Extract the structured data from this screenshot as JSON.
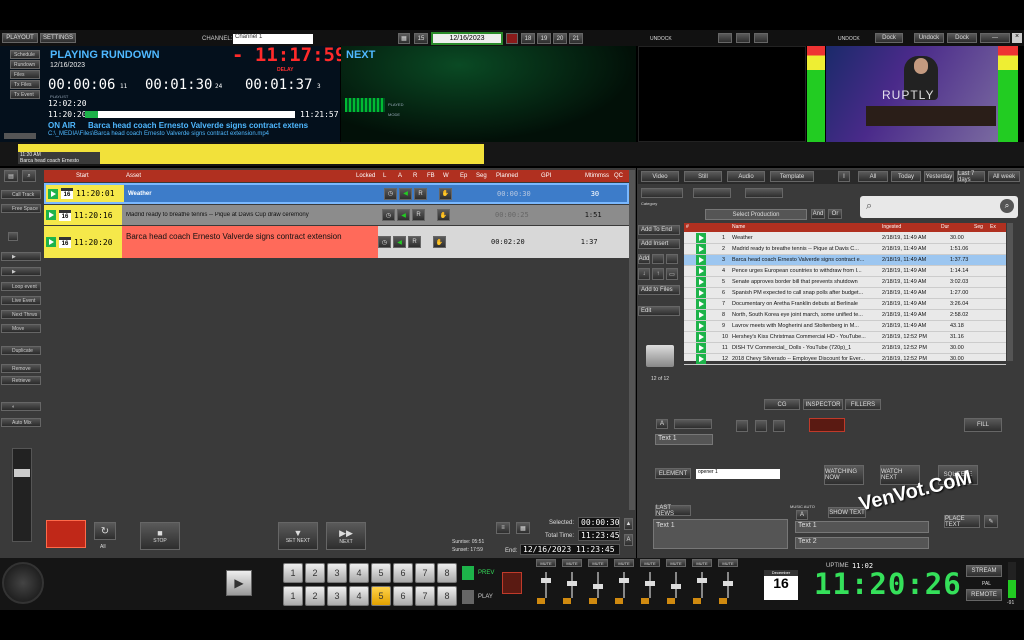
{
  "top_tabs": [
    "PLAYOUT",
    "SETTINGS"
  ],
  "channel": {
    "label": "CHANNEL:",
    "value": "Channel 1"
  },
  "date_nav": {
    "value": "12/16/2023",
    "days": [
      "15",
      "18",
      "19",
      "20",
      "21"
    ]
  },
  "playing": {
    "title": "PLAYING RUNDOWN",
    "date": "12/16/2023",
    "countdown": "- 11:17:59",
    "delay_label": "DELAY",
    "elapsed": "00:00:06",
    "elapsed_frames": "11",
    "remain": "00:01:30",
    "remain_frames": "24",
    "total": "00:01:37",
    "total_frames": "3",
    "playlist_label": "PLAYLIST",
    "on_air_label": "ON AIR",
    "start_time": "12:02:20",
    "time_a": "11:20:20",
    "time_b": "11:21:57",
    "onair_clip": "Barca head coach Ernesto Valverde signs contract extens",
    "onair_path": "C:\\_MEDIA\\Files\\Barca head coach Ernesto Valverde signs contract extension.mp4"
  },
  "next": {
    "title": "NEXT",
    "played_label": "PLAYED",
    "mode_label": "MODE"
  },
  "mini_side": [
    "Schedule",
    "Rundown",
    "Files",
    "Tx Files",
    "Tx Event"
  ],
  "timeline": {
    "time": "11:20 AM",
    "clip": "Barca head coach Ernesto"
  },
  "undock": [
    "UNDOCK",
    "UNDOCK"
  ],
  "top_right_buttons": [
    "Dock",
    "Undock",
    "Dock",
    "Undock"
  ],
  "preview": {
    "watermark": "RUPTLY"
  },
  "columns": [
    "Start",
    "Asset",
    "Locked",
    "L",
    "A",
    "R",
    "FB",
    "W",
    "Ep",
    "Seg",
    "Planned",
    "GPI",
    "Mtimmss",
    "QC"
  ],
  "rows": [
    {
      "start": "11:20:01",
      "date": "16",
      "asset": "Weather",
      "planned": "00:00:30",
      "dur": "30"
    },
    {
      "start": "11:20:16",
      "date": "16",
      "asset": "Madrid ready to breathe tennis -- Pique at Davis Cup draw ceremony",
      "planned": "00:00:25",
      "dur": "1:51"
    },
    {
      "start": "11:20:20",
      "date": "16",
      "asset": "Barca head coach Ernesto Valverde signs contract extension",
      "planned": "00:02:20",
      "dur": "1:37"
    }
  ],
  "left_side": [
    "Call Track",
    "Free Space",
    "",
    "",
    "",
    "Loop event",
    "Live Event",
    "Next Thrws",
    "Move",
    "Duplicate",
    "Remove",
    "Retrieve",
    "Auto Mix"
  ],
  "bottom_controls": {
    "stop": "STOP",
    "set_next": "SET NEXT",
    "next": "NEXT",
    "all": "All"
  },
  "sun": {
    "sunrise": "Sunrise: 05:51",
    "sunset": "Sunset: 17:59"
  },
  "totals": {
    "selected_label": "Selected:",
    "selected": "00:00:30",
    "total_label": "Total Time:",
    "total": "11:23:45",
    "end_label": "End:",
    "end": "12/16/2023 11:23:45"
  },
  "lib_tabs": [
    "Video",
    "Still",
    "Audio",
    "Template"
  ],
  "filter_tabs": [
    "All",
    "Today",
    "Yesterday",
    "Last 7 days",
    "All week"
  ],
  "production": {
    "category": "Category",
    "select": "Select Production",
    "and": "And",
    "or": "Or"
  },
  "lib_buttons": [
    "Add To End",
    "Add Insert",
    "Add",
    "Add to Files",
    "Edit"
  ],
  "lib_columns": [
    "#",
    "Name",
    "Ingested",
    "Dur",
    "Seg",
    "Ex"
  ],
  "lib_rows": [
    {
      "n": "1",
      "name": "Weather",
      "ing": "2/18/19, 11:49 AM",
      "dur": "30.00"
    },
    {
      "n": "2",
      "name": "Madrid ready to breathe tennis -- Pique at Davis C...",
      "ing": "2/18/19, 11:49 AM",
      "dur": "1:51.06"
    },
    {
      "n": "3",
      "name": "Barca head coach Ernesto Valverde signs contract e...",
      "ing": "2/18/19, 11:49 AM",
      "dur": "1:37.73"
    },
    {
      "n": "4",
      "name": "Pence urges European countries to withdraw from I...",
      "ing": "2/18/19, 11:49 AM",
      "dur": "1:14.14"
    },
    {
      "n": "5",
      "name": "Senate approves border bill that prevents shutdown",
      "ing": "2/18/19, 11:49 AM",
      "dur": "3:02.03"
    },
    {
      "n": "6",
      "name": "Spanish PM expected to call snap polls after budget...",
      "ing": "2/18/19, 11:49 AM",
      "dur": "1:27.00"
    },
    {
      "n": "7",
      "name": "Documentary on Aretha Franklin debuts at Berlinale",
      "ing": "2/18/19, 11:49 AM",
      "dur": "3:26.04"
    },
    {
      "n": "8",
      "name": "North, South Korea eye joint march, some unified te...",
      "ing": "2/18/19, 11:49 AM",
      "dur": "2:58.02"
    },
    {
      "n": "9",
      "name": "Lavrov meets with Mogherini and Stoltenberg in M...",
      "ing": "2/18/19, 11:49 AM",
      "dur": "43.18"
    },
    {
      "n": "10",
      "name": "Hershey's Kiss Christmas Commercial HD - YouTube...",
      "ing": "2/18/19, 12:52 PM",
      "dur": "31.16"
    },
    {
      "n": "11",
      "name": "DISH TV Commercial_ Dolls - YouTube (720p)_1",
      "ing": "2/18/19, 12:52 PM",
      "dur": "30.00"
    },
    {
      "n": "12",
      "name": "2018 Chevy Silverado -- Employee Discount for Ever...",
      "ing": "2/18/19, 12:52 PM",
      "dur": "30.00"
    }
  ],
  "lib_count": "12 of 12",
  "lower_tabs": [
    "CG",
    "INSPECTOR",
    "FILLERS"
  ],
  "cg": {
    "text1": "Text 1",
    "element_label": "ELEMENT",
    "element_value": "opener 1",
    "watching_now": "WATCHING NOW",
    "watch_next": "WATCH NEXT",
    "squeeze": "SQUEEZE",
    "last_news": "LAST NEWS",
    "music_auto": "MUSIC AUTO",
    "text_a": "Text 1",
    "text_b": "Text 1",
    "text_c": "Text 2",
    "show_text": "SHOW TEXT",
    "place": "PLACE TEXT",
    "fill": "FILL"
  },
  "numpad": [
    "1",
    "2",
    "3",
    "4",
    "5",
    "6",
    "7",
    "8"
  ],
  "numpad_active": 5,
  "prev_label": "PREV",
  "play_label": "PLAY",
  "mixer_labels": [
    "MUTE",
    "MUTE",
    "MUTE",
    "MUTE",
    "MUTE",
    "MUTE",
    "MUTE",
    "MUTE"
  ],
  "clock": {
    "uptime_label": "UPTIME",
    "uptime": "11:02",
    "time": "11:20:26",
    "day": "16",
    "month": "December"
  },
  "status": {
    "stream": "STREAM",
    "pal": "PAL",
    "remote": "REMOTE"
  },
  "watermark": "VenVot.CoM",
  "audio_level_label": "-91"
}
